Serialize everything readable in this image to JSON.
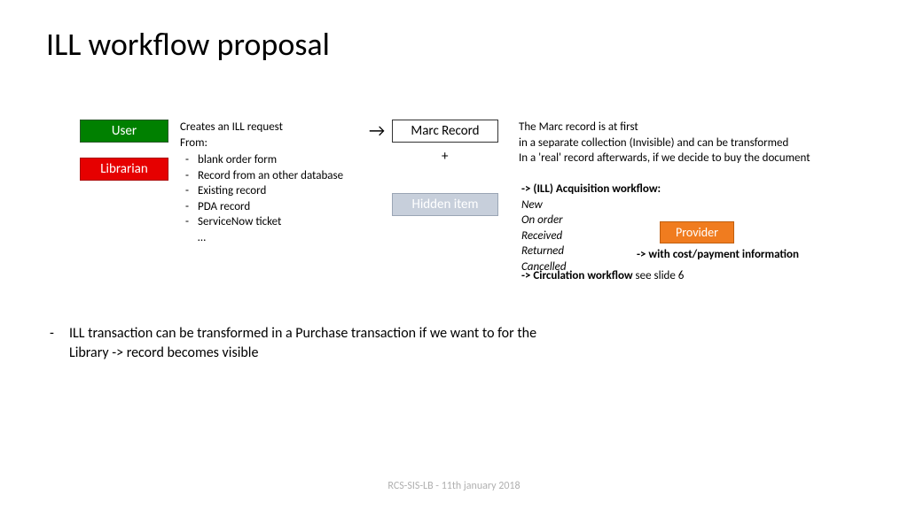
{
  "title": "ILL workflow proposal",
  "boxes": {
    "user": "User",
    "librarian": "Librarian",
    "marc": "Marc Record",
    "hidden": "Hidden item",
    "provider": "Provider"
  },
  "plus": "+",
  "arrow": "→",
  "creates": {
    "line1": "Creates an ILL request",
    "line2": "From:",
    "items": {
      "i0": "blank order form",
      "i1": "Record from an other database",
      "i2": "Existing record",
      "i3": "PDA record",
      "i4": "ServiceNow ticket"
    },
    "ellipsis": "…"
  },
  "marc_desc": {
    "l1": "The Marc record is at first",
    "l2": "in a separate collection (Invisible) and can be transformed",
    "l3": "In a 'real' record afterwards, if we decide to buy the document"
  },
  "acq": {
    "header": "-> (ILL) Acquisition workflow:",
    "s0": "New",
    "s1": "On order",
    "s2": "Received",
    "s3": "Returned",
    "s4": "Cancelled"
  },
  "cost": "-> with cost/payment information",
  "circ": {
    "bold": "-> Circulation workflow ",
    "rest": "see slide 6"
  },
  "main_bullet": {
    "l1": "ILL transaction can be transformed in a Purchase transaction if we want to  for the",
    "l2": "Library -> record becomes visible"
  },
  "footer": "RCS-SIS-LB - 11th january 2018"
}
